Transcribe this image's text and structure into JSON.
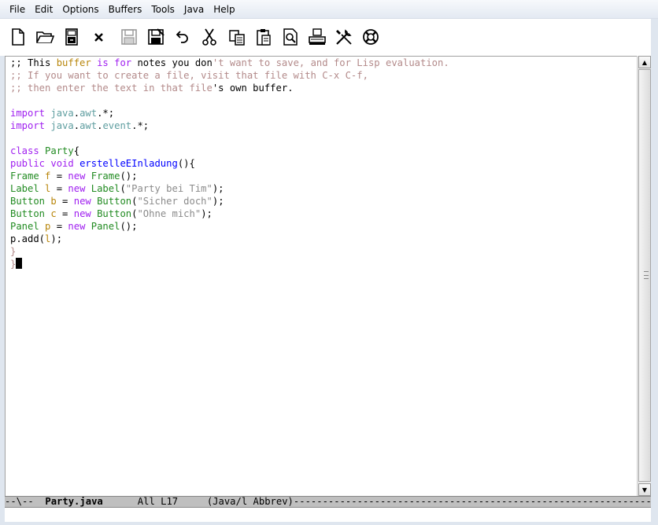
{
  "menubar": {
    "items": [
      {
        "label": "File"
      },
      {
        "label": "Edit"
      },
      {
        "label": "Options"
      },
      {
        "label": "Buffers"
      },
      {
        "label": "Tools"
      },
      {
        "label": "Java"
      },
      {
        "label": "Help"
      }
    ]
  },
  "toolbar": {
    "tools": [
      {
        "icon": "new-file-icon"
      },
      {
        "icon": "open-folder-icon"
      },
      {
        "icon": "dired-icon"
      },
      {
        "icon": "close-icon"
      },
      {
        "icon": "save-icon"
      },
      {
        "icon": "save-as-icon"
      },
      {
        "icon": "undo-icon"
      },
      {
        "icon": "cut-icon"
      },
      {
        "icon": "copy-icon"
      },
      {
        "icon": "paste-icon"
      },
      {
        "icon": "search-icon"
      },
      {
        "icon": "print-icon"
      },
      {
        "icon": "preferences-icon"
      },
      {
        "icon": "help-icon"
      }
    ]
  },
  "editor": {
    "lines": [
      [
        {
          "t": ";; This ",
          "c": ""
        },
        {
          "t": "buffer",
          "c": "c-var"
        },
        {
          "t": " ",
          "c": ""
        },
        {
          "t": "is",
          "c": "c-kw"
        },
        {
          "t": " ",
          "c": ""
        },
        {
          "t": "for",
          "c": "c-kw"
        },
        {
          "t": " notes you don",
          "c": ""
        },
        {
          "t": "'t want to save, and for Lisp evaluation.",
          "c": "c-com"
        }
      ],
      [
        {
          "t": ";; If you want to create a file, visit that file with C-x C-f,",
          "c": "c-com"
        }
      ],
      [
        {
          "t": ";; then enter the text in that file",
          "c": "c-com"
        },
        {
          "t": "'s own buffer.",
          "c": ""
        }
      ],
      [],
      [
        {
          "t": "import",
          "c": "c-kw"
        },
        {
          "t": " ",
          "c": ""
        },
        {
          "t": "java",
          "c": "c-pkg"
        },
        {
          "t": ".",
          "c": ""
        },
        {
          "t": "awt",
          "c": "c-pkg"
        },
        {
          "t": ".*;",
          "c": ""
        }
      ],
      [
        {
          "t": "import",
          "c": "c-kw"
        },
        {
          "t": " ",
          "c": ""
        },
        {
          "t": "java",
          "c": "c-pkg"
        },
        {
          "t": ".",
          "c": ""
        },
        {
          "t": "awt",
          "c": "c-pkg"
        },
        {
          "t": ".",
          "c": ""
        },
        {
          "t": "event",
          "c": "c-pkg"
        },
        {
          "t": ".*;",
          "c": ""
        }
      ],
      [],
      [
        {
          "t": "class",
          "c": "c-kw"
        },
        {
          "t": " ",
          "c": ""
        },
        {
          "t": "Party",
          "c": "c-type"
        },
        {
          "t": "{",
          "c": ""
        }
      ],
      [
        {
          "t": "public",
          "c": "c-kw"
        },
        {
          "t": " ",
          "c": ""
        },
        {
          "t": "void",
          "c": "c-kw"
        },
        {
          "t": " ",
          "c": ""
        },
        {
          "t": "erstelleEInladung",
          "c": "c-fn"
        },
        {
          "t": "(){",
          "c": ""
        }
      ],
      [
        {
          "t": "Frame",
          "c": "c-type"
        },
        {
          "t": " ",
          "c": ""
        },
        {
          "t": "f",
          "c": "c-var"
        },
        {
          "t": " = ",
          "c": ""
        },
        {
          "t": "new",
          "c": "c-kw"
        },
        {
          "t": " ",
          "c": ""
        },
        {
          "t": "Frame",
          "c": "c-type"
        },
        {
          "t": "();",
          "c": ""
        }
      ],
      [
        {
          "t": "Label",
          "c": "c-type"
        },
        {
          "t": " ",
          "c": ""
        },
        {
          "t": "l",
          "c": "c-var"
        },
        {
          "t": " = ",
          "c": ""
        },
        {
          "t": "new",
          "c": "c-kw"
        },
        {
          "t": " ",
          "c": ""
        },
        {
          "t": "Label",
          "c": "c-type"
        },
        {
          "t": "(",
          "c": ""
        },
        {
          "t": "\"Party bei Tim\"",
          "c": "c-str"
        },
        {
          "t": ");",
          "c": ""
        }
      ],
      [
        {
          "t": "Button",
          "c": "c-type"
        },
        {
          "t": " ",
          "c": ""
        },
        {
          "t": "b",
          "c": "c-var"
        },
        {
          "t": " = ",
          "c": ""
        },
        {
          "t": "new",
          "c": "c-kw"
        },
        {
          "t": " ",
          "c": ""
        },
        {
          "t": "Button",
          "c": "c-type"
        },
        {
          "t": "(",
          "c": ""
        },
        {
          "t": "\"Sicher doch\"",
          "c": "c-str"
        },
        {
          "t": ");",
          "c": ""
        }
      ],
      [
        {
          "t": "Button",
          "c": "c-type"
        },
        {
          "t": " ",
          "c": ""
        },
        {
          "t": "c",
          "c": "c-var"
        },
        {
          "t": " = ",
          "c": ""
        },
        {
          "t": "new",
          "c": "c-kw"
        },
        {
          "t": " ",
          "c": ""
        },
        {
          "t": "Button",
          "c": "c-type"
        },
        {
          "t": "(",
          "c": ""
        },
        {
          "t": "\"Ohne mich\"",
          "c": "c-str"
        },
        {
          "t": ");",
          "c": ""
        }
      ],
      [
        {
          "t": "Panel",
          "c": "c-type"
        },
        {
          "t": " ",
          "c": ""
        },
        {
          "t": "p",
          "c": "c-var"
        },
        {
          "t": " = ",
          "c": ""
        },
        {
          "t": "new",
          "c": "c-kw"
        },
        {
          "t": " ",
          "c": ""
        },
        {
          "t": "Panel",
          "c": "c-type"
        },
        {
          "t": "();",
          "c": ""
        }
      ],
      [
        {
          "t": "p.add(",
          "c": ""
        },
        {
          "t": "l",
          "c": "c-var"
        },
        {
          "t": ");",
          "c": ""
        }
      ],
      [
        {
          "t": "}",
          "c": "c-com"
        }
      ],
      [
        {
          "t": "}",
          "c": "c-com"
        },
        {
          "t": "",
          "c": "cursor"
        }
      ]
    ]
  },
  "modeline": {
    "prefix": "--\\--  ",
    "buffer_name": "Party.java",
    "position": "      All L17     ",
    "modes": "(Java/l Abbrev)",
    "fill": "------------------------------------------------------------------------------------------------"
  }
}
